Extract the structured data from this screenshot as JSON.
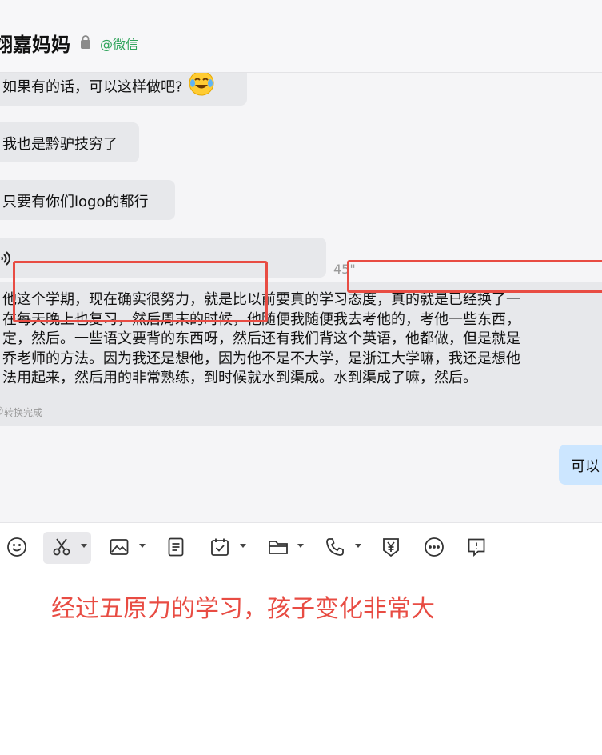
{
  "header": {
    "contact_name": "翊嘉妈妈",
    "source_tag": "@微信"
  },
  "messages": [
    {
      "id": "m1",
      "text": "如果有的话，可以这样做吧?",
      "emoji": "laughing-crying-emoji"
    },
    {
      "id": "m2",
      "text": "我也是黔驴技穷了"
    },
    {
      "id": "m3",
      "text": "只要有你们logo的都行"
    }
  ],
  "voice_message": {
    "duration": "45\"",
    "transcript_lines": [
      "他这个学期，现在确实很努力，就是比以前要真的学习态度，真的就是已经换了一",
      "在每天晚上也复习，然后周末的时候，他随便我随便我去考他的，考他一些东西，",
      "定，然后。一些语文要背的东西呀，然后还有我们背这个英语，他都做，但是就是",
      "乔老师的方法。因为我还是想他，因为他不是不大学，是浙江大学嘛，我还是想他",
      "法用起来，然后用的非常熟练，到时候就水到渠成。水到渠成了嘛，然后。"
    ],
    "status": "转换完成"
  },
  "outgoing": {
    "text": "可以"
  },
  "toolbar": {
    "icons": [
      "emoji-icon",
      "scissors-icon",
      "image-icon",
      "document-icon",
      "calendar-check-icon",
      "folder-icon",
      "phone-icon",
      "yuan-shield-icon",
      "more-icon",
      "chat-history-icon"
    ]
  },
  "input": {
    "value": ""
  },
  "annotation": {
    "caption": "经过五原力的学习，孩子变化非常大",
    "color": "#e84c43"
  },
  "colors": {
    "bubble_in": "#e7e8eb",
    "bubble_out": "#cce6ff",
    "wechat_green": "#2fa35b"
  }
}
